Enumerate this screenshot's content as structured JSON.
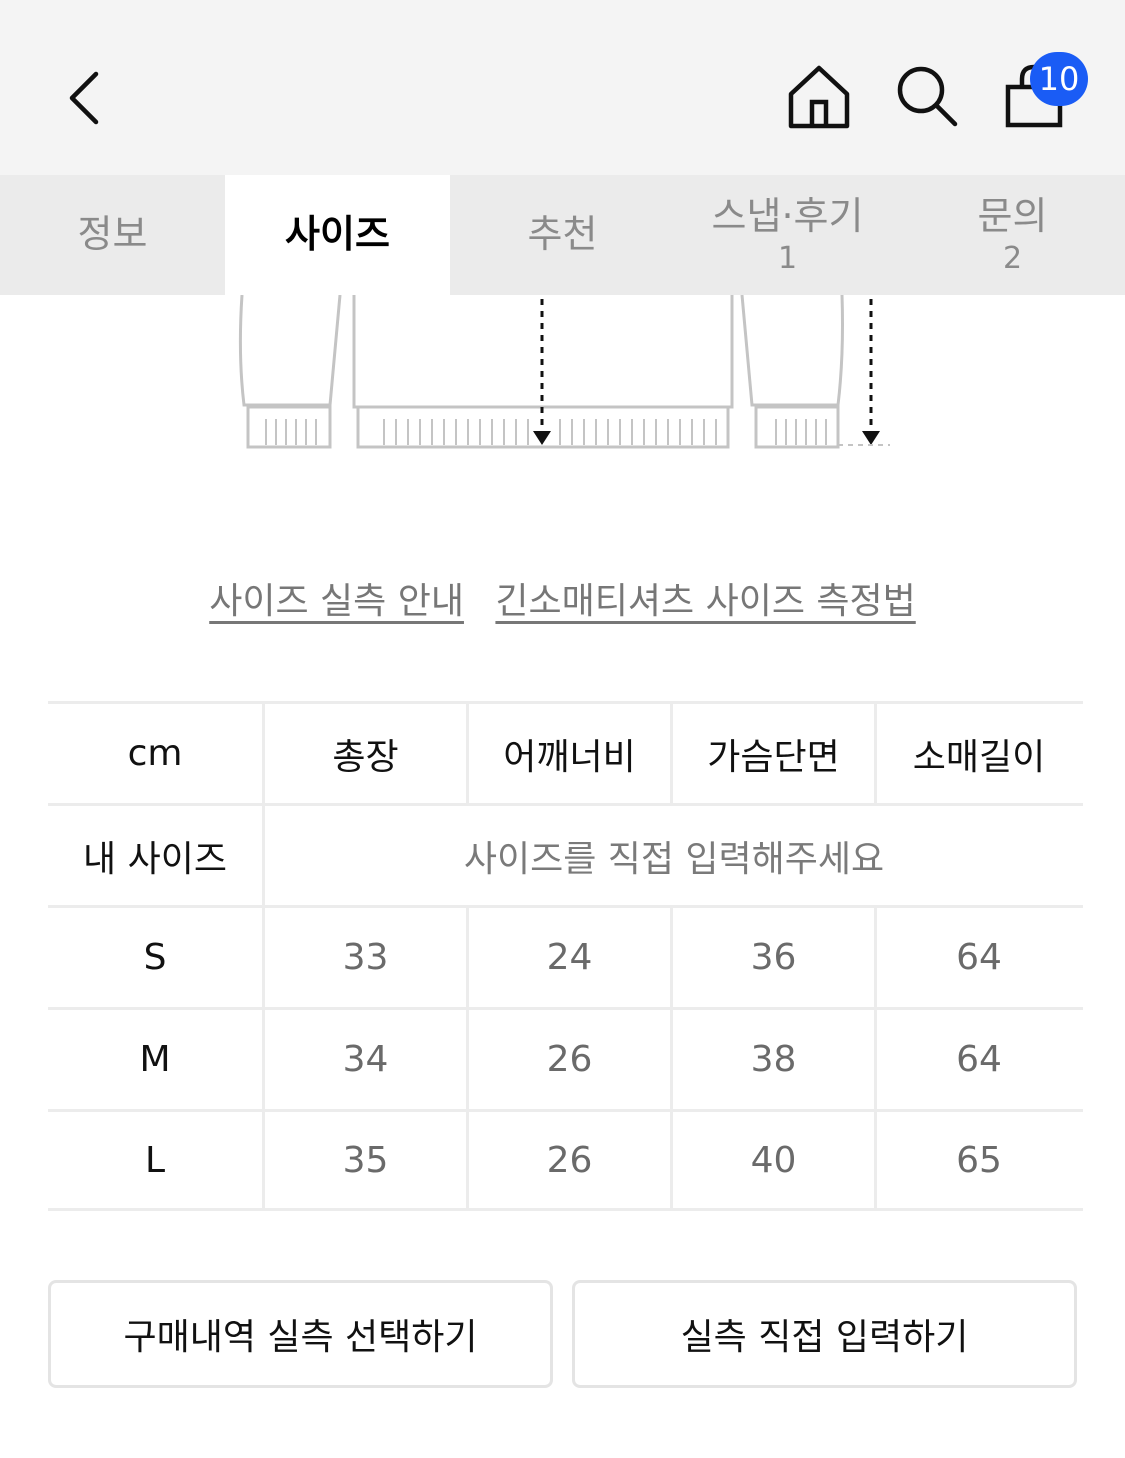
{
  "header": {
    "cart_count": "10",
    "icons": [
      "chevron-left-icon",
      "home-icon",
      "search-icon",
      "shopping-bag-icon"
    ],
    "badge_color": "#1a5cf5"
  },
  "tabs": [
    {
      "label": "정보",
      "count": ""
    },
    {
      "label": "사이즈",
      "count": "",
      "active": true
    },
    {
      "label": "추천",
      "count": ""
    },
    {
      "label": "스냅·후기",
      "count": "1"
    },
    {
      "label": "문의",
      "count": "2"
    }
  ],
  "links": {
    "size_guide": "사이즈 실측 안내",
    "measure_method": "긴소매티셔츠 사이즈 측정법"
  },
  "table": {
    "unit": "cm",
    "columns": [
      "총장",
      "어깨너비",
      "가슴단면",
      "소매길이"
    ],
    "my_size_label": "내 사이즈",
    "my_size_placeholder": "사이즈를 직접 입력해주세요",
    "rows": [
      {
        "size": "S",
        "values": [
          "33",
          "24",
          "36",
          "64"
        ]
      },
      {
        "size": "M",
        "values": [
          "34",
          "26",
          "38",
          "64"
        ]
      },
      {
        "size": "L",
        "values": [
          "35",
          "26",
          "40",
          "65"
        ]
      }
    ]
  },
  "buttons": {
    "select_purchase": "구매내역 실측 선택하기",
    "direct_input": "실측 직접 입력하기"
  }
}
